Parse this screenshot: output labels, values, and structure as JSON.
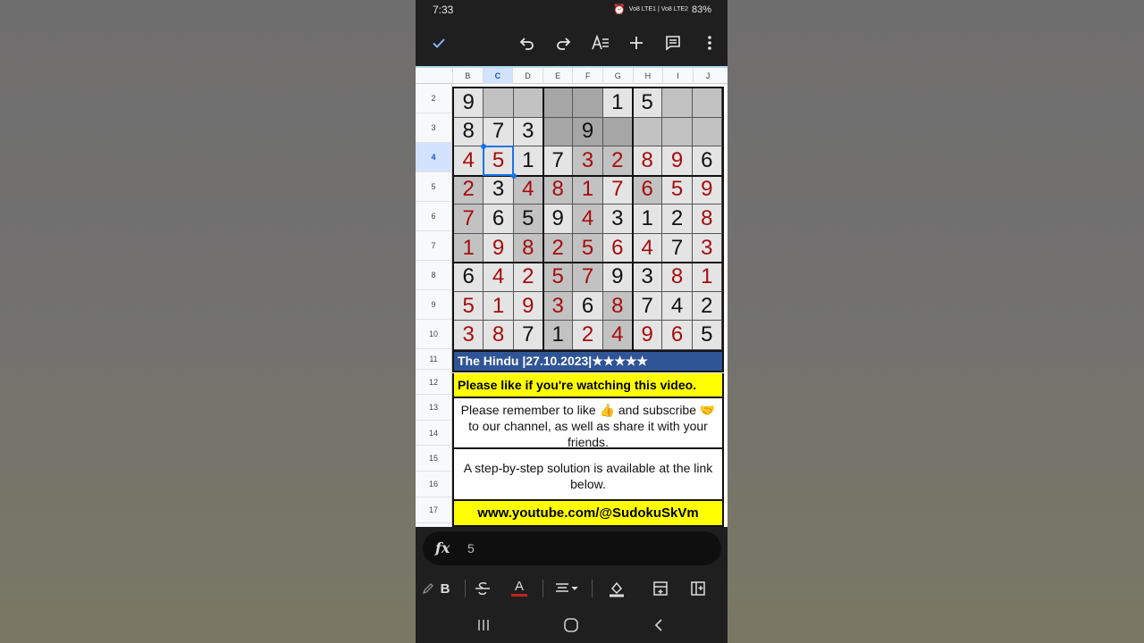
{
  "status": {
    "time": "7:33",
    "network": "Vo8 LTE1 | Vo8 LTE2",
    "battery": "83%"
  },
  "toolbar": {
    "icons": [
      "check-icon",
      "undo-icon",
      "redo-icon",
      "text-format-icon",
      "add-icon",
      "comment-icon",
      "more-vert-icon"
    ]
  },
  "sheet": {
    "columns": [
      "B",
      "C",
      "D",
      "E",
      "F",
      "G",
      "H",
      "I",
      "J"
    ],
    "active_column": "C",
    "rows": [
      "2",
      "3",
      "4",
      "5",
      "6",
      "7",
      "8",
      "9",
      "10",
      "11",
      "12",
      "13",
      "14",
      "15",
      "16",
      "17"
    ],
    "active_row": "4",
    "sudoku": [
      [
        "9",
        "",
        "",
        "",
        "",
        "1",
        "5",
        "",
        ""
      ],
      [
        "8",
        "7",
        "3",
        "",
        "9",
        "",
        "",
        "",
        ""
      ],
      [
        "4",
        "5",
        "1",
        "7",
        "3",
        "2",
        "8",
        "9",
        "6"
      ],
      [
        "2",
        "3",
        "4",
        "8",
        "1",
        "7",
        "6",
        "5",
        "9"
      ],
      [
        "7",
        "6",
        "5",
        "9",
        "4",
        "3",
        "1",
        "2",
        "8"
      ],
      [
        "1",
        "9",
        "8",
        "2",
        "5",
        "6",
        "4",
        "7",
        "3"
      ],
      [
        "6",
        "4",
        "2",
        "5",
        "7",
        "9",
        "3",
        "8",
        "1"
      ],
      [
        "5",
        "1",
        "9",
        "3",
        "6",
        "8",
        "7",
        "4",
        "2"
      ],
      [
        "3",
        "8",
        "7",
        "1",
        "2",
        "4",
        "9",
        "6",
        "5"
      ]
    ],
    "red_mask": [
      [
        0,
        0,
        0,
        0,
        0,
        0,
        0,
        0,
        0
      ],
      [
        0,
        0,
        0,
        0,
        0,
        0,
        0,
        0,
        0
      ],
      [
        1,
        1,
        0,
        0,
        1,
        1,
        1,
        1,
        0
      ],
      [
        1,
        0,
        1,
        1,
        1,
        1,
        1,
        1,
        1
      ],
      [
        1,
        0,
        0,
        0,
        1,
        0,
        0,
        0,
        1
      ],
      [
        1,
        1,
        1,
        1,
        1,
        1,
        1,
        0,
        1
      ],
      [
        0,
        1,
        1,
        1,
        1,
        0,
        0,
        1,
        1
      ],
      [
        1,
        1,
        1,
        1,
        0,
        1,
        0,
        0,
        0
      ],
      [
        1,
        1,
        0,
        0,
        1,
        1,
        1,
        1,
        0
      ]
    ],
    "shade_mask": [
      [
        0,
        1,
        1,
        2,
        2,
        0,
        0,
        1,
        1
      ],
      [
        0,
        0,
        0,
        2,
        2,
        2,
        1,
        1,
        1
      ],
      [
        0,
        0,
        0,
        0,
        1,
        1,
        0,
        0,
        0
      ],
      [
        1,
        0,
        1,
        1,
        1,
        0,
        1,
        0,
        0
      ],
      [
        1,
        0,
        1,
        0,
        1,
        0,
        0,
        0,
        0
      ],
      [
        1,
        0,
        1,
        1,
        1,
        0,
        0,
        0,
        0
      ],
      [
        0,
        0,
        0,
        1,
        1,
        0,
        0,
        0,
        0
      ],
      [
        0,
        0,
        0,
        1,
        0,
        1,
        0,
        0,
        0
      ],
      [
        0,
        0,
        0,
        1,
        0,
        1,
        0,
        0,
        0
      ]
    ],
    "colors": {
      "red_digit": "#a50d0d",
      "black_digit": "#111111",
      "cell_light": "#e4e4e4",
      "cell_mid": "#c2c2c2",
      "cell_dark": "#a6a6a6"
    },
    "banner_hindu": "The Hindu |27.10.2023|★★★★★",
    "banner_like": "Please like if you're watching this video.",
    "banner_remember": "Please remember to like 👍 and subscribe 🤝 to our channel, as well as share it with your friends.",
    "banner_step": "A step-by-step solution is available at the link below.",
    "banner_url": "www.youtube.com/@SudokuSkVm"
  },
  "formula": {
    "label": "fx",
    "value": "5"
  },
  "format_bar": {
    "icons": [
      "pencil-icon",
      "bold-icon",
      "strikethrough-icon",
      "text-color-icon",
      "align-icon",
      "fill-color-icon",
      "insert-row-icon",
      "insert-column-icon"
    ],
    "bold_label": "B",
    "text_color_label": "A"
  },
  "nav": {
    "icons": [
      "recents-icon",
      "home-icon",
      "back-icon"
    ]
  }
}
